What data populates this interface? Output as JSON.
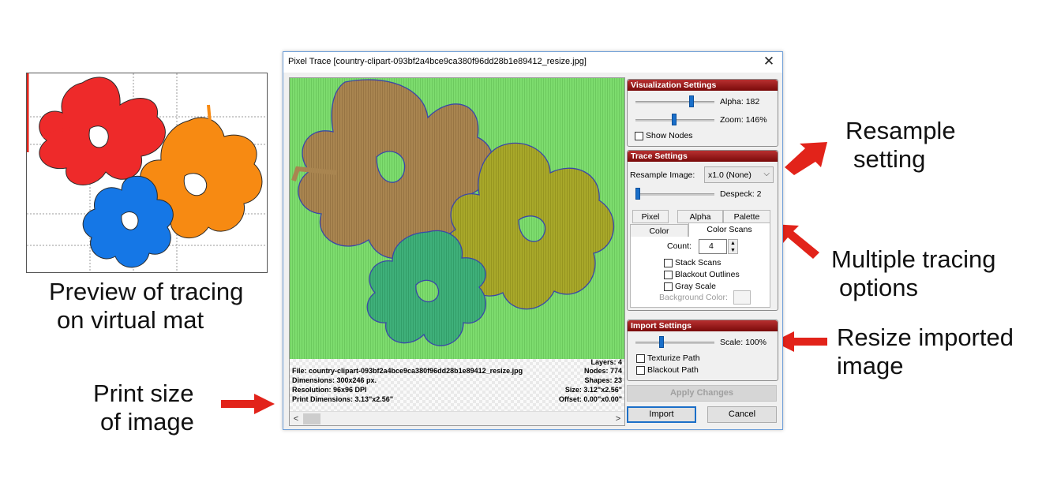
{
  "annotations": {
    "preview": [
      "Preview of tracing",
      "on virtual mat"
    ],
    "print_size": [
      "Print size",
      "of image"
    ],
    "resample": [
      "Resample",
      "setting"
    ],
    "multiple": [
      "Multiple tracing",
      "options"
    ],
    "resize": [
      "Resize imported",
      "image"
    ]
  },
  "dialog": {
    "title": "Pixel Trace [country-clipart-093bf2a4bce9ca380f96dd28b1e89412_resize.jpg]",
    "close": "✕"
  },
  "info": {
    "layers": "Layers: 4",
    "file": "File:  country-clipart-093bf2a4bce9ca380f96dd28b1e89412_resize.jpg",
    "nodes": "Nodes: 774",
    "dimensions": "Dimensions: 300x246 px.",
    "shapes": "Shapes: 23",
    "resolution": "Resolution: 96x96 DPI",
    "size": "Size: 3.12\"x2.56\"",
    "print_dimensions": "Print Dimensions: 3.13\"x2.56\"",
    "offset": "Offset: 0.00\"x0.00\""
  },
  "scroll": {
    "left": "<",
    "right": ">"
  },
  "visualization": {
    "header": "Visualization Settings",
    "alpha_label": "Alpha: 182",
    "alpha_value": 182,
    "zoom_label": "Zoom: 146%",
    "zoom_value": 146,
    "show_nodes": "Show Nodes"
  },
  "trace": {
    "header": "Trace Settings",
    "resample_label": "Resample Image:",
    "resample_value": "x1.0 (None)",
    "despeck_label": "Despeck: 2",
    "tabs_row1": [
      "Pixel",
      "Alpha",
      "Palette"
    ],
    "tabs_row2": [
      "Color",
      "Color Scans"
    ],
    "count_label": "Count:",
    "count_value": "4",
    "stack_scans": "Stack Scans",
    "blackout_outlines": "Blackout Outlines",
    "gray_scale": "Gray Scale",
    "background_color": "Background Color:"
  },
  "import": {
    "header": "Import Settings",
    "scale_label": "Scale: 100%",
    "scale_value": 100,
    "texturize": "Texturize Path",
    "blackout_path": "Blackout Path"
  },
  "buttons": {
    "apply": "Apply Changes",
    "import": "Import",
    "cancel": "Cancel"
  },
  "colors": {
    "arrow": "#e2231a",
    "bg_green": "#7ddc6e",
    "flower_brown": "#a98550",
    "flower_olive": "#a8a82a",
    "flower_teal": "#3fb07a",
    "mat_red": "#ee2a2a",
    "mat_orange": "#f78a12",
    "mat_blue": "#1577e6",
    "header_red": "#9c1a1a"
  }
}
